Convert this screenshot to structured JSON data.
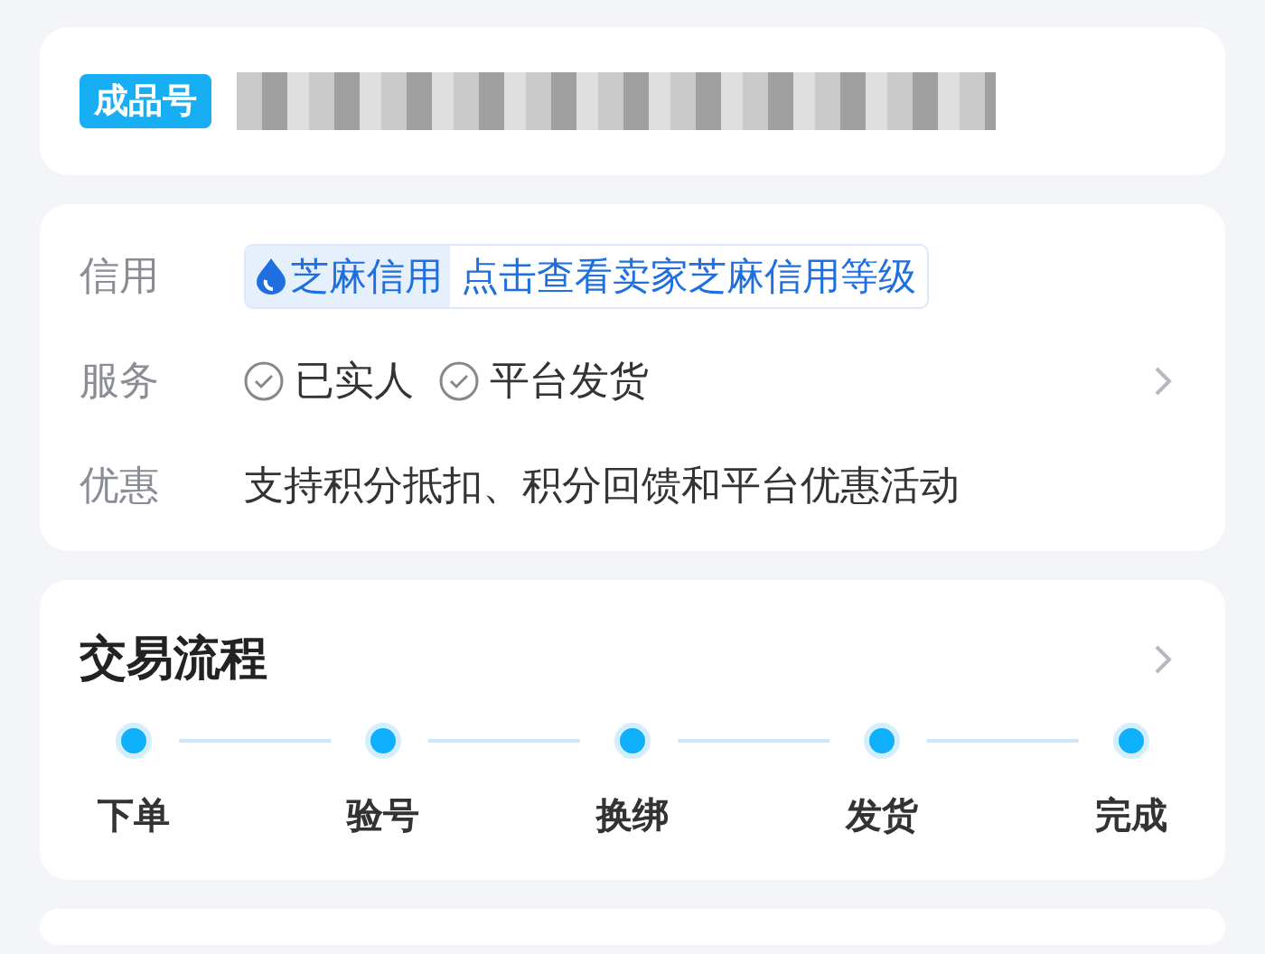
{
  "product": {
    "badge": "成品号"
  },
  "info": {
    "rows": [
      {
        "kind": "credit",
        "label": "信用",
        "tag": "芝麻信用",
        "link": "点击查看卖家芝麻信用等级"
      },
      {
        "kind": "services",
        "label": "服务",
        "items": [
          "已实人",
          "平台发货"
        ]
      },
      {
        "kind": "text",
        "label": "优惠",
        "text": "支持积分抵扣、积分回馈和平台优惠活动"
      }
    ]
  },
  "process": {
    "title": "交易流程",
    "steps": [
      "下单",
      "验号",
      "换绑",
      "发货",
      "完成"
    ]
  }
}
